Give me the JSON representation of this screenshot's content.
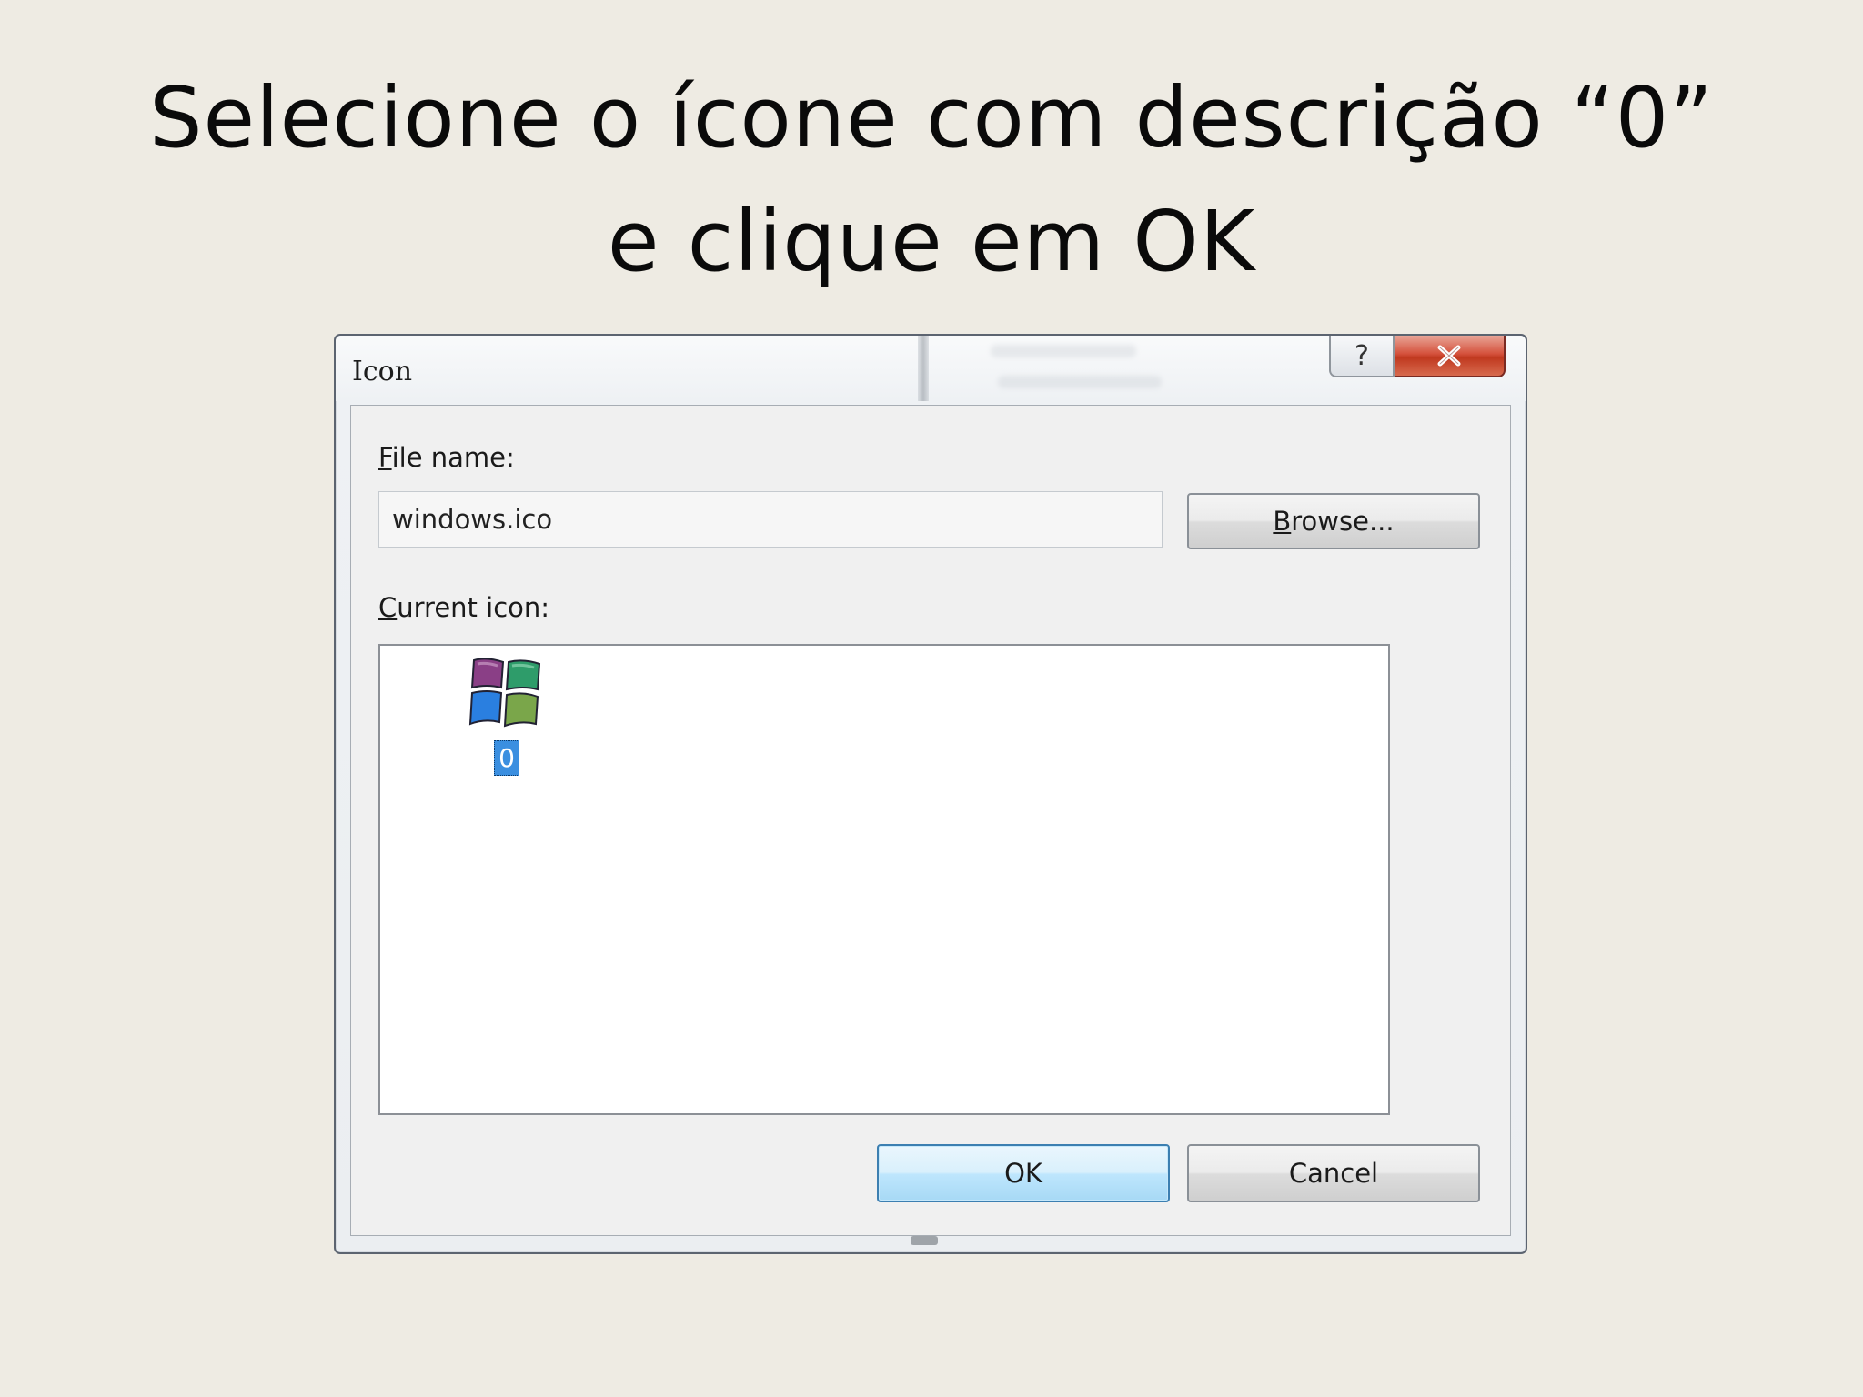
{
  "slide": {
    "title_line1": "Selecione o ícone com descrição “0”",
    "title_line2": "e clique em OK"
  },
  "dialog": {
    "title": "Icon",
    "help_label": "?",
    "file_name_label_accel": "F",
    "file_name_label_rest": "ile name:",
    "file_name_value": "windows.ico",
    "browse_accel": "B",
    "browse_rest": "rowse...",
    "current_icon_label_accel": "C",
    "current_icon_label_rest": "urrent icon:",
    "icons": [
      {
        "caption": "0",
        "selected": true,
        "icon": "windows-flag-icon"
      }
    ],
    "ok_label": "OK",
    "cancel_label": "Cancel"
  },
  "colors": {
    "background": "#eeebe3",
    "selection": "#3b8fe0",
    "close_button": "#c0391f",
    "ok_border": "#3c7fb1"
  }
}
